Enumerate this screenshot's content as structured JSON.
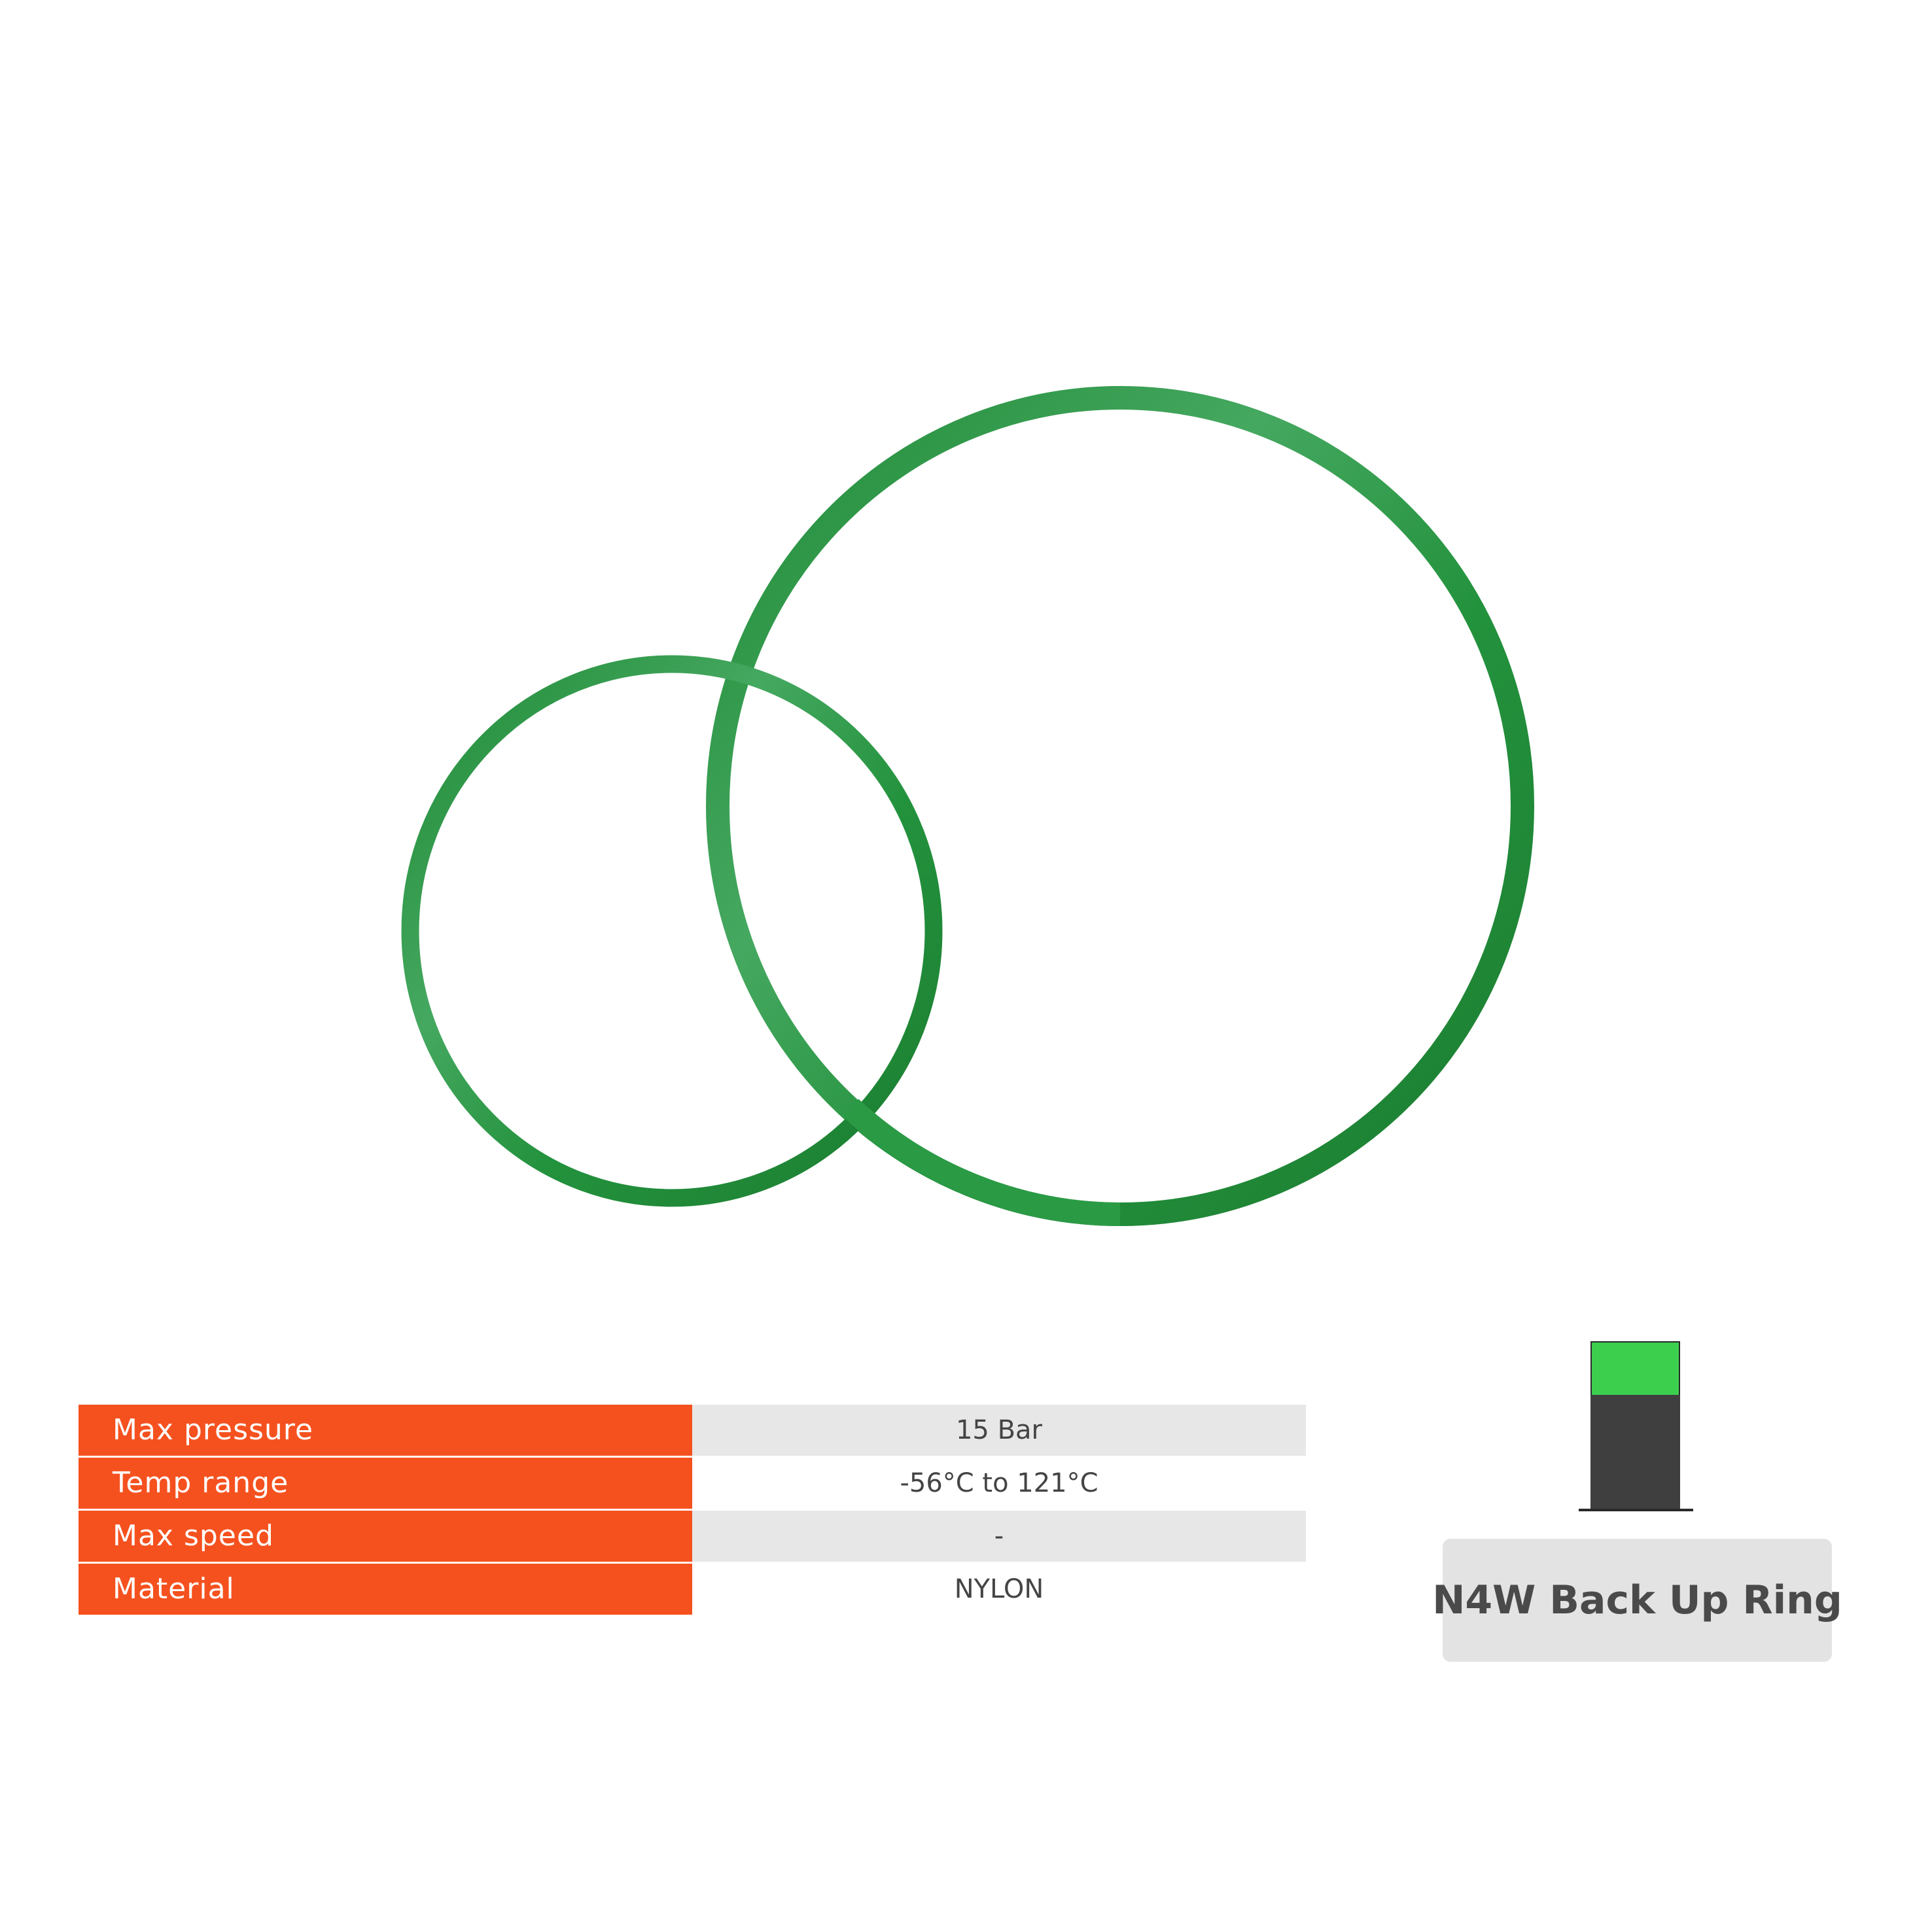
{
  "colors": {
    "ring_green": "#239a3e",
    "label_orange": "#f5511f",
    "profile_green": "#3ccf4e",
    "profile_dark": "#3f3f3f",
    "badge_bg": "#e3e3e3"
  },
  "specs": [
    {
      "label": "Max pressure",
      "value": "15 Bar"
    },
    {
      "label": "Temp range",
      "value": "-56°C to 121°C"
    },
    {
      "label": "Max speed",
      "value": "-"
    },
    {
      "label": "Material",
      "value": "NYLON"
    }
  ],
  "product_name": "N4W Back Up Ring",
  "icons": [
    "backup-ring-photo",
    "seal-profile-icon"
  ]
}
